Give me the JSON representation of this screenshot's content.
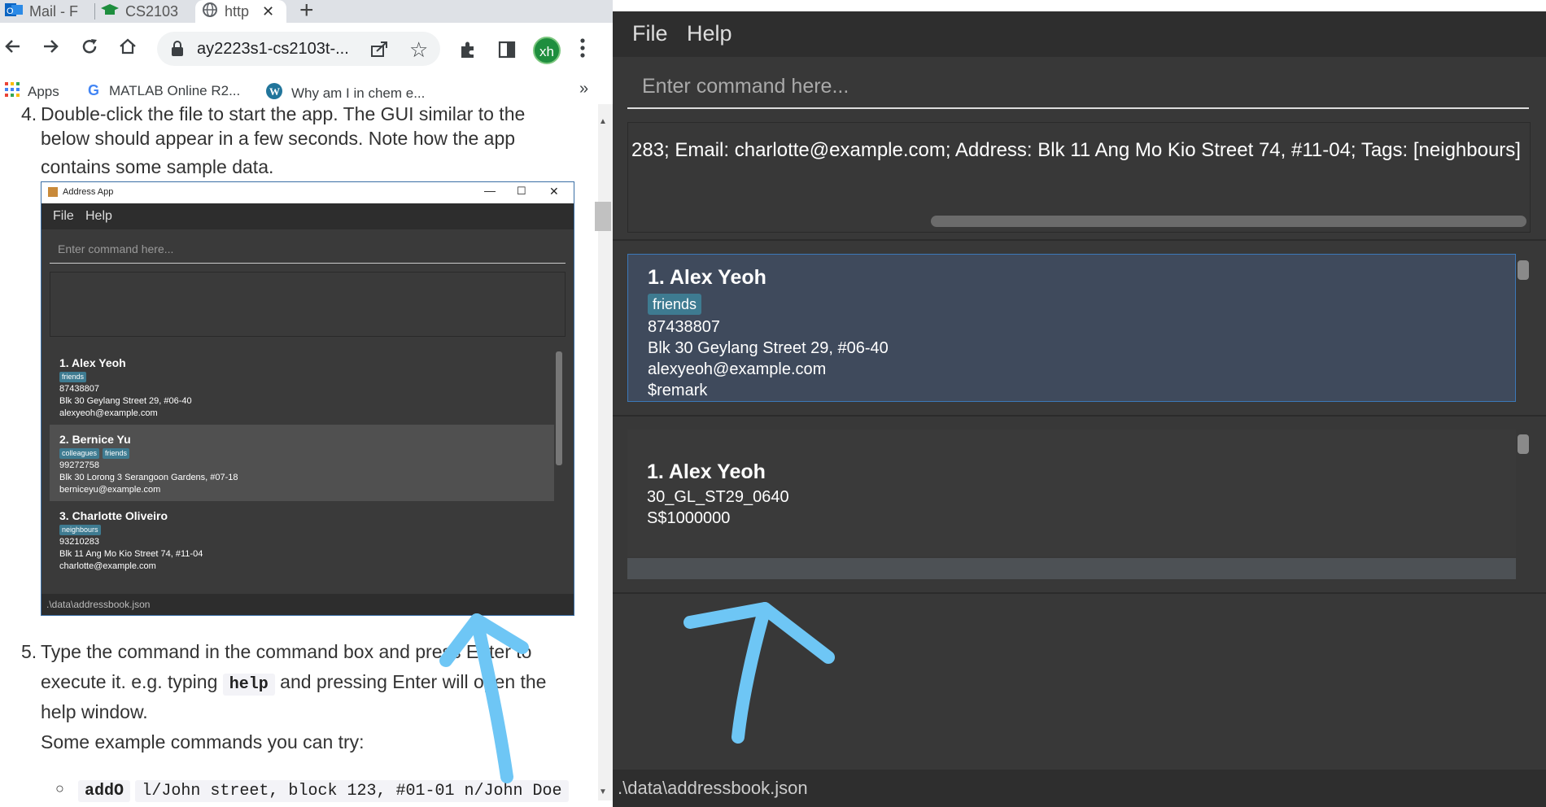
{
  "browser": {
    "tabs": [
      {
        "label": "Mail - F",
        "icon": "outlook-icon"
      },
      {
        "label": "CS2103",
        "icon": "graduation-cap-icon"
      },
      {
        "label": "http",
        "icon": "globe-icon",
        "close": "✕"
      }
    ],
    "new_tab": "+",
    "url": "ay2223s1-cs2103t-...",
    "profile_initials": "xh",
    "bookmarks": [
      {
        "label": "Apps",
        "icon": "apps-grid-icon"
      },
      {
        "label": "MATLAB Online R2...",
        "icon": "google-icon"
      },
      {
        "label": "Why am I in chem e...",
        "icon": "wordpress-icon"
      }
    ],
    "bookmarks_overflow": "»"
  },
  "doc": {
    "step4_prefix": "4.",
    "step4_line1": "Double-click the file to start the app. The GUI similar to the",
    "step4_line2": "below should appear in a few seconds. Note how the app",
    "step4_line3": "contains some sample data.",
    "step5_prefix": "5.",
    "step5_line1": "Type the command in the command box and press Enter to",
    "step5_line2a": "execute it. e.g. typing",
    "step5_code": "help",
    "step5_line2b": "and pressing Enter will open the",
    "step5_line3": "help window.",
    "step5_line4": "Some example commands you can try:",
    "bullet": "○",
    "example_cmd": "addO",
    "example_rest": "l/John street, block 123, #01-01 n/John Doe"
  },
  "screenshot": {
    "title": "Address App",
    "menu": [
      "File",
      "Help"
    ],
    "command_placeholder": "Enter command here...",
    "status": ".\\data\\addressbook.json",
    "persons": [
      {
        "name": "1.  Alex Yeoh",
        "tags": [
          "friends"
        ],
        "phone": "87438807",
        "address": "Blk 30 Geylang Street 29, #06-40",
        "email": "alexyeoh@example.com"
      },
      {
        "name": "2.  Bernice Yu",
        "tags": [
          "colleagues",
          "friends"
        ],
        "phone": "99272758",
        "address": "Blk 30 Lorong 3 Serangoon Gardens, #07-18",
        "email": "berniceyu@example.com"
      },
      {
        "name": "3.  Charlotte Oliveiro",
        "tags": [
          "neighbours"
        ],
        "phone": "93210283",
        "address": "Blk 11 Ang Mo Kio Street 74, #11-04",
        "email": "charlotte@example.com"
      }
    ]
  },
  "app": {
    "menu": [
      "File",
      "Help"
    ],
    "command_placeholder": "Enter command here...",
    "result_text": "283; Email: charlotte@example.com; Address: Blk 11 Ang Mo Kio Street 74, #11-04; Tags: [neighbours]",
    "person_card": {
      "name": "1.  Alex Yeoh",
      "tag": "friends",
      "phone": "87438807",
      "address": "Blk 30 Geylang Street 29, #06-40",
      "email": "alexyeoh@example.com",
      "remark": "$remark"
    },
    "property_card": {
      "name": "1.  Alex Yeoh",
      "line1": "30_GL_ST29_0640",
      "line2": "S$1000000"
    },
    "status": ".\\data\\addressbook.json"
  },
  "colors": {
    "annotation_arrow": "#6ec6f5",
    "tag_bg": "#3e7b91",
    "selected_card_bg": "#3f4a5c"
  }
}
